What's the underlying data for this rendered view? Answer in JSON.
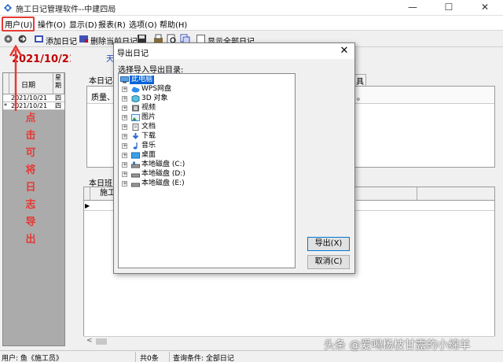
{
  "window": {
    "title": "施工日记管理软件--中建四局",
    "controls": [
      "—",
      "☐",
      "✕"
    ]
  },
  "menu": [
    "用户(U)",
    "操作(O)",
    "显示(D)",
    "报表(R)",
    "选项(O)",
    "帮助(H)"
  ],
  "toolbar": {
    "add_label": "添加日记",
    "delete_label": "删除当前日记",
    "show_all_label": "显示全部日记"
  },
  "left": {
    "current_date": "2021/10/21",
    "col_date": "日期",
    "col_weekday": "星期",
    "rows": [
      {
        "marker": "",
        "date": "2021/10/21",
        "weekday": "四"
      },
      {
        "marker": "*",
        "date": "2021/10/21",
        "weekday": "四"
      }
    ]
  },
  "annotation": [
    "点",
    "击",
    "可",
    "将",
    "日",
    "志",
    "导",
    "出"
  ],
  "main": {
    "weather_fragment": "天",
    "section1_tab": "本日记事",
    "section1_right_tab": "具",
    "section1_row_fragment": "质量、",
    "section1_row_end": "。",
    "section2_label": "本日班",
    "table_col1": "施工",
    "table_col2": "",
    "table_col3": ""
  },
  "status": {
    "user": "用户: 鱼《施工员》",
    "count": "共0条",
    "query": "查询条件: 全部日记"
  },
  "watermark": "头条 @爱喝杨枝甘露的小绵羊",
  "dialog": {
    "title": "导出日记",
    "close": "✕",
    "prompt": "选择导入导出目录:",
    "tree": [
      {
        "label": "此电脑",
        "icon": "computer-icon",
        "root": true
      },
      {
        "label": "WPS网盘",
        "icon": "cloud-icon"
      },
      {
        "label": "3D 对象",
        "icon": "cube-icon"
      },
      {
        "label": "视频",
        "icon": "video-icon"
      },
      {
        "label": "图片",
        "icon": "picture-icon"
      },
      {
        "label": "文档",
        "icon": "document-icon"
      },
      {
        "label": "下载",
        "icon": "download-icon"
      },
      {
        "label": "音乐",
        "icon": "music-icon"
      },
      {
        "label": "桌面",
        "icon": "desktop-icon"
      },
      {
        "label": "本地磁盘 (C:)",
        "icon": "drive-icon"
      },
      {
        "label": "本地磁盘 (D:)",
        "icon": "drive-icon"
      },
      {
        "label": "本地磁盘 (E:)",
        "icon": "drive-icon"
      }
    ],
    "export_button": "导出(X)",
    "cancel_button": "取消(C)"
  },
  "colors": {
    "annotation_red": "#e53935",
    "date_red": "#c00000",
    "selection_blue": "#0a64d6"
  }
}
